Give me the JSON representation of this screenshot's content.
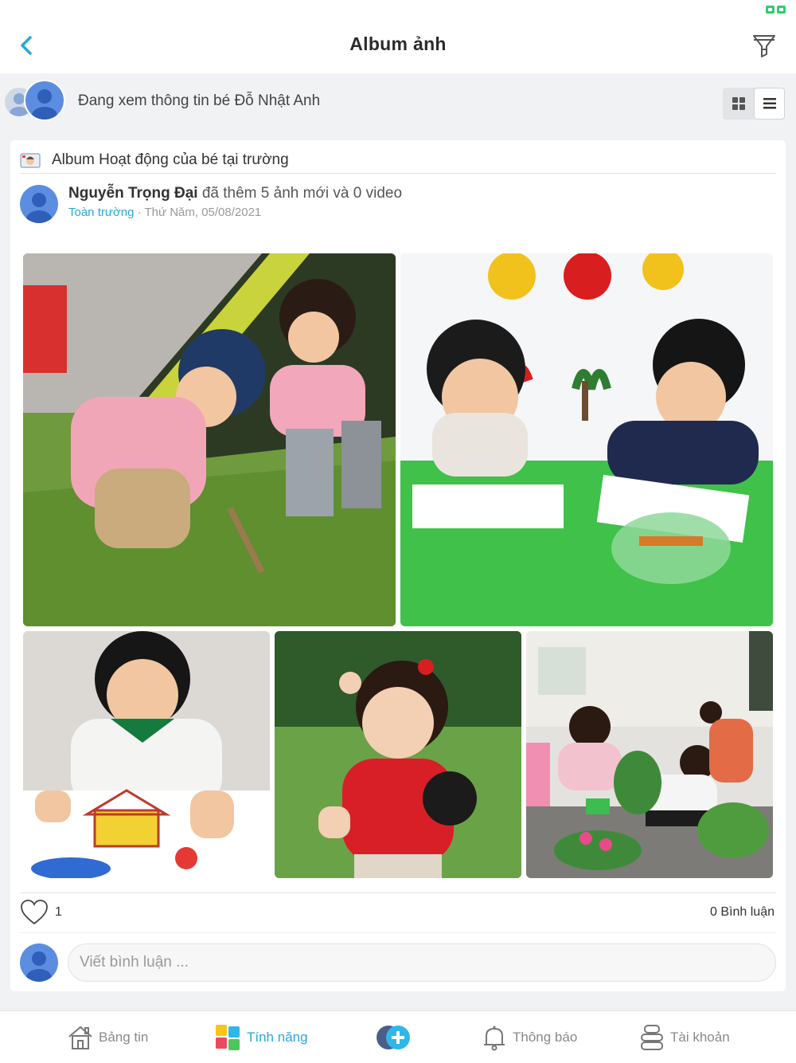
{
  "header": {
    "title": "Album ảnh",
    "back_icon": "chevron-left-icon",
    "filter_icon": "filter-funnel-icon"
  },
  "student_bar": {
    "text": "Đang xem thông tin bé Đỗ Nhật Anh",
    "views": [
      "grid-view-icon",
      "list-view-icon"
    ],
    "active_view": "list"
  },
  "post": {
    "album_prefix": "Album",
    "album_name": "Hoạt động của bé tại trường",
    "poster_name": "Nguyễn  Trọng  Đại",
    "action_text": " đã thêm 5 ảnh mới và 0 video",
    "scope": "Toàn trường",
    "date": " · Thứ Năm, 05/08/2021",
    "like_count": "1",
    "comment_count": "0 Bình luận",
    "comment_placeholder": "Viết bình luận ..."
  },
  "bottom_nav": [
    {
      "label": "Bảng tin",
      "icon": "home-icon"
    },
    {
      "label": "Tính năng",
      "icon": "puzzle-icon",
      "active": true
    },
    {
      "label": "",
      "icon": "add-circle-icon"
    },
    {
      "label": "Thông báo",
      "icon": "bell-icon"
    },
    {
      "label": "Tài khoản",
      "icon": "account-icon"
    }
  ],
  "colors": {
    "accent": "#29a7d8",
    "avatar": "#5b8de0",
    "background": "#f1f2f4"
  }
}
